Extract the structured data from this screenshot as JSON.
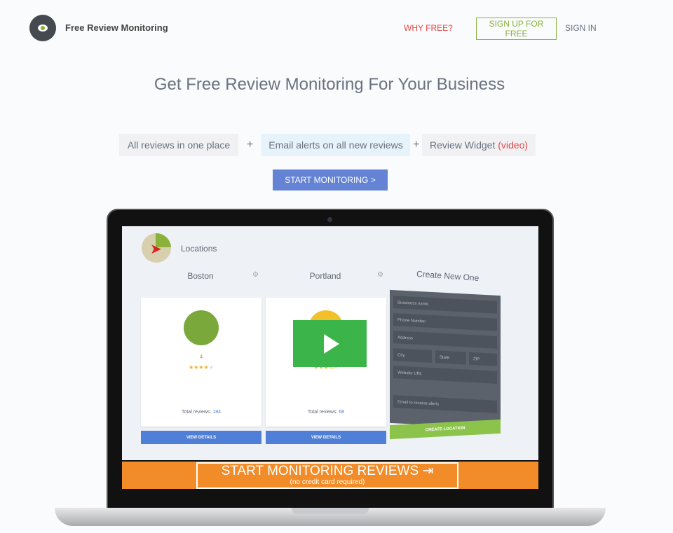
{
  "header": {
    "brand": "Free Review Monitoring",
    "nav": {
      "why_free": "WHY FREE?",
      "sign_up": "SIGN UP FOR FREE",
      "sign_in": "SIGN IN"
    }
  },
  "hero": {
    "title": "Get Free Review Monitoring For Your Business",
    "features": [
      "All reviews in one place",
      "Email alerts on all new reviews",
      "Review Widget"
    ],
    "video_link": "(video)",
    "plus": "+",
    "cta": "START MONITORING >"
  },
  "video": {
    "locations_title": "Locations",
    "cards": [
      {
        "city": "Boston",
        "rating": "4",
        "total_label": "Total reviews:",
        "total": "184",
        "button": "VIEW DETAILS",
        "stars": 4
      },
      {
        "city": "Portland",
        "rating": "",
        "total_label": "Total reviews:",
        "total": "68",
        "button": "VIEW DETAILS",
        "stars": 3.5
      }
    ],
    "create": {
      "title": "Create New One",
      "fields": [
        "Bussiness name",
        "Phone Number",
        "Address",
        "City",
        "State",
        "ZIP",
        "Website URL",
        "Email to receive alerts"
      ],
      "button": "CREATE LOCATION"
    },
    "banner": {
      "title": "START MONITORING REVIEWS ⇥",
      "sub": "(no credit card required)"
    }
  },
  "colors": {
    "accent": "#6483d4",
    "green": "#8ab23a",
    "red": "#e04848",
    "orange": "#f28c28",
    "play": "#3bb54a"
  }
}
